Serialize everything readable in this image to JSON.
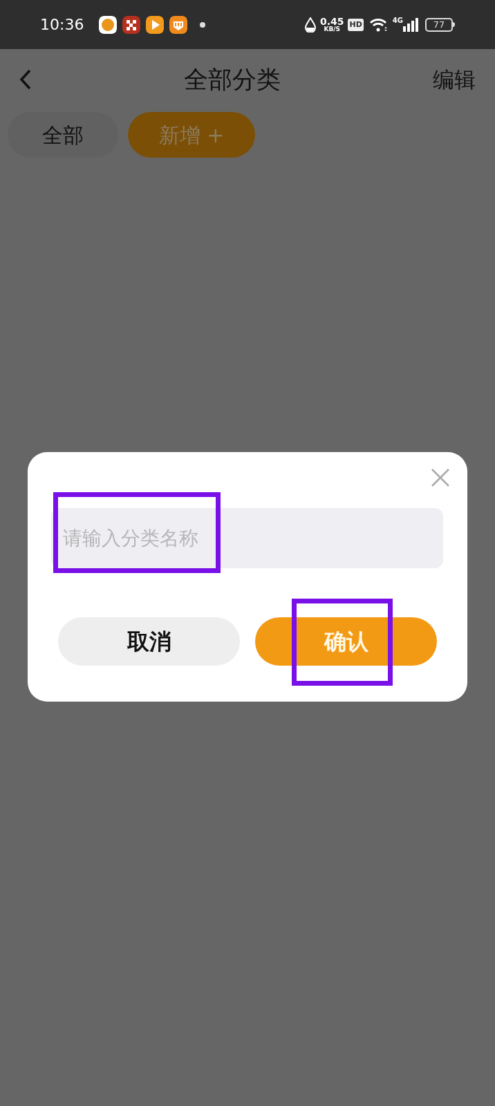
{
  "status_bar": {
    "time": "10:36",
    "speed_value": "0.45",
    "speed_unit": "KB/S",
    "hd_badge": "HD",
    "network": "4G",
    "battery": "77"
  },
  "header": {
    "title": "全部分类",
    "action": "编辑"
  },
  "chips": [
    {
      "label": "全部",
      "kind": "plain"
    },
    {
      "label": "新增 +",
      "kind": "accent"
    }
  ],
  "dialog": {
    "input": {
      "placeholder": "请输入分类名称",
      "highlighted": true
    },
    "buttons": [
      {
        "label": "取消",
        "kind": "secondary",
        "highlighted": false
      },
      {
        "label": "确认",
        "kind": "primary",
        "highlighted": true
      }
    ]
  }
}
